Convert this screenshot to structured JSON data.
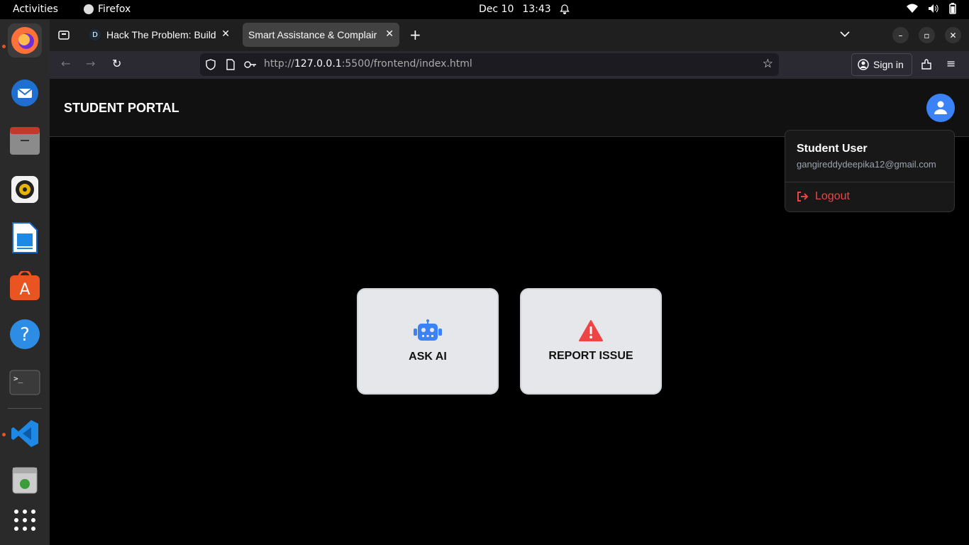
{
  "system": {
    "activities": "Activities",
    "app_name": "Firefox",
    "date": "Dec 10",
    "time": "13:43"
  },
  "browser": {
    "tabs": [
      {
        "label": "Hack The Problem: Build"
      },
      {
        "label": "Smart Assistance & Complair"
      }
    ],
    "url_prefix": "http://",
    "url_host": "127.0.0.1",
    "url_rest": ":5500/frontend/index.html",
    "signin_label": "Sign in"
  },
  "page": {
    "title": "STUDENT PORTAL",
    "user": {
      "name": "Student User",
      "email": "gangireddydeepika12@gmail.com",
      "logout_label": "Logout"
    },
    "cards": [
      {
        "label": "ASK AI",
        "icon": "robot-icon",
        "color": "#3b82f6"
      },
      {
        "label": "REPORT ISSUE",
        "icon": "warning-icon",
        "color": "#ef4444"
      }
    ]
  }
}
